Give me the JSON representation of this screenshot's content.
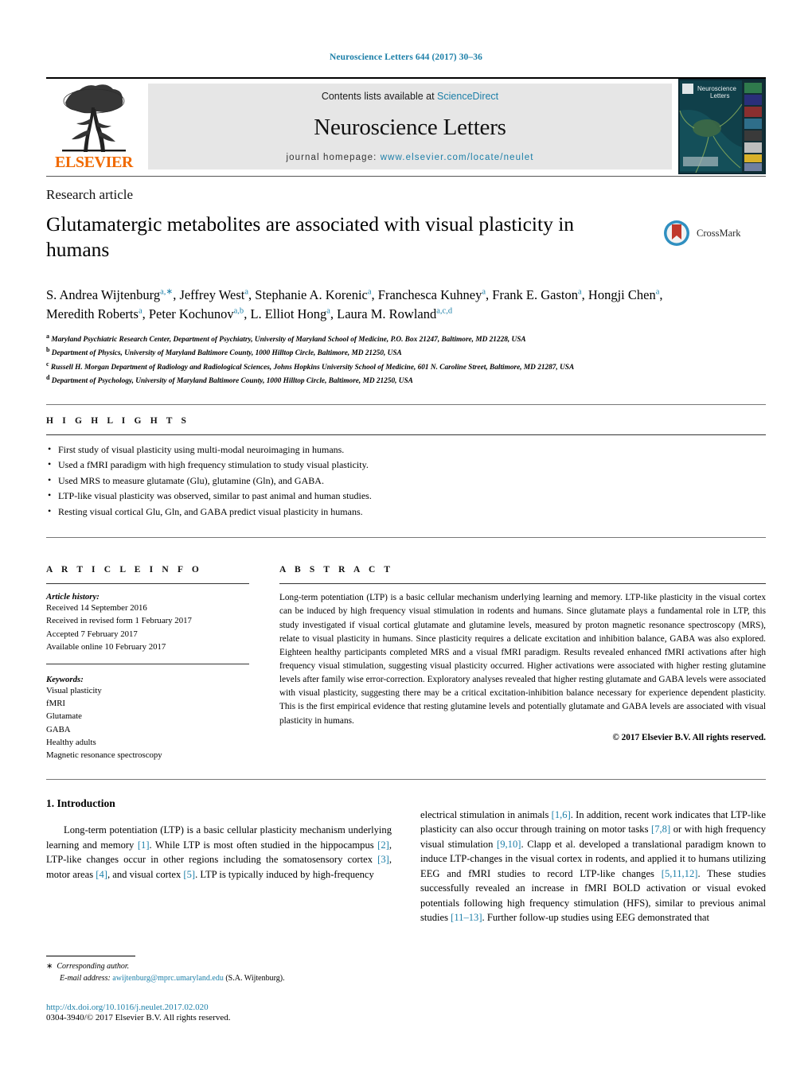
{
  "running_head": "Neuroscience Letters 644 (2017) 30–36",
  "masthead": {
    "publisher_name": "ELSEVIER",
    "contents_prefix": "Contents lists available at ",
    "contents_link": "ScienceDirect",
    "journal_name": "Neuroscience Letters",
    "homepage_prefix": "journal homepage: ",
    "homepage_link": "www.elsevier.com/locate/neulet",
    "cover_title": "Neuroscience Letters"
  },
  "article": {
    "type": "Research article",
    "title": "Glutamatergic metabolites are associated with visual plasticity in humans",
    "crossmark_label": "CrossMark",
    "authors_html": "S. Andrea Wijtenburg<sup>a,∗</sup>, Jeffrey West<sup>a</sup>, Stephanie A. Korenic<sup>a</sup>, Franchesca Kuhney<sup>a</sup>, Frank E. Gaston<sup>a</sup>, Hongji Chen<sup>a</sup>, Meredith Roberts<sup>a</sup>, Peter Kochunov<sup>a,b</sup>, L. Elliot Hong<sup>a</sup>, Laura M. Rowland<sup>a,c,d</sup>",
    "affiliations": [
      {
        "marker": "a",
        "text": "Maryland Psychiatric Research Center, Department of Psychiatry, University of Maryland School of Medicine, P.O. Box 21247, Baltimore, MD 21228, USA"
      },
      {
        "marker": "b",
        "text": "Department of Physics, University of Maryland Baltimore County, 1000 Hilltop Circle, Baltimore, MD 21250, USA"
      },
      {
        "marker": "c",
        "text": "Russell H. Morgan Department of Radiology and Radiological Sciences, Johns Hopkins University School of Medicine, 601 N. Caroline Street, Baltimore, MD 21287, USA"
      },
      {
        "marker": "d",
        "text": "Department of Psychology, University of Maryland Baltimore County, 1000 Hilltop Circle, Baltimore, MD 21250, USA"
      }
    ]
  },
  "highlights": {
    "heading": "H I G H L I G H T S",
    "items": [
      "First study of visual plasticity using multi-modal neuroimaging in humans.",
      "Used a fMRI paradigm with high frequency stimulation to study visual plasticity.",
      "Used MRS to measure glutamate (Glu), glutamine (Gln), and GABA.",
      "LTP-like visual plasticity was observed, similar to past animal and human studies.",
      "Resting visual cortical Glu, Gln, and GABA predict visual plasticity in humans."
    ]
  },
  "article_info": {
    "heading": "A R T I C L E   I N F O",
    "history_label": "Article history:",
    "history": [
      "Received 14 September 2016",
      "Received in revised form 1 February 2017",
      "Accepted 7 February 2017",
      "Available online 10 February 2017"
    ],
    "keywords_label": "Keywords:",
    "keywords": [
      "Visual plasticity",
      "fMRI",
      "Glutamate",
      "GABA",
      "Healthy adults",
      "Magnetic resonance spectroscopy"
    ]
  },
  "abstract": {
    "heading": "A B S T R A C T",
    "text": "Long-term potentiation (LTP) is a basic cellular mechanism underlying learning and memory. LTP-like plasticity in the visual cortex can be induced by high frequency visual stimulation in rodents and humans. Since glutamate plays a fundamental role in LTP, this study investigated if visual cortical glutamate and glutamine levels, measured by proton magnetic resonance spectroscopy (MRS), relate to visual plasticity in humans. Since plasticity requires a delicate excitation and inhibition balance, GABA was also explored. Eighteen healthy participants completed MRS and a visual fMRI paradigm. Results revealed enhanced fMRI activations after high frequency visual stimulation, suggesting visual plasticity occurred. Higher activations were associated with higher resting glutamine levels after family wise error-correction. Exploratory analyses revealed that higher resting glutamate and GABA levels were associated with visual plasticity, suggesting there may be a critical excitation-inhibition balance necessary for experience dependent plasticity. This is the first empirical evidence that resting glutamine levels and potentially glutamate and GABA levels are associated with visual plasticity in humans.",
    "copyright": "© 2017 Elsevier B.V. All rights reserved."
  },
  "body": {
    "section_number_title": "1.  Introduction",
    "left_paragraph_html": "Long-term potentiation (LTP) is a basic cellular plasticity mechanism underlying learning and memory <span class=\"link\">[1]</span>. While LTP is most often studied in the hippocampus <span class=\"link\">[2]</span>, LTP-like changes occur in other regions including the somatosensory cortex <span class=\"link\">[3]</span>, motor areas <span class=\"link\">[4]</span>, and visual cortex <span class=\"link\">[5]</span>. LTP is typically induced by high-frequency",
    "right_paragraph_html": "electrical stimulation in animals <span class=\"link\">[1,6]</span>. In addition, recent work indicates that LTP-like plasticity can also occur through training on motor tasks <span class=\"link\">[7,8]</span> or with high frequency visual stimulation <span class=\"link\">[9,10]</span>. Clapp et al. developed a translational paradigm known to induce LTP-changes in the visual cortex in rodents, and applied it to humans utilizing EEG and fMRI studies to record LTP-like changes <span class=\"link\">[5,11,12]</span>. These studies successfully revealed an increase in fMRI BOLD activation or visual evoked potentials following high frequency stimulation (HFS), similar to previous animal studies <span class=\"link\">[11–13]</span>. Further follow-up studies using EEG demonstrated that"
  },
  "footnotes": {
    "corresponding_star": "∗",
    "corresponding_label": "Corresponding author.",
    "email_label": "E-mail address:",
    "email": "awijtenburg@mprc.umaryland.edu",
    "email_suffix": "(S.A. Wijtenburg).",
    "doi": "http://dx.doi.org/10.1016/j.neulet.2017.02.020",
    "issn": "0304-3940/© 2017 Elsevier B.V. All rights reserved."
  },
  "colors": {
    "link_blue": "#1c7fa8",
    "elsevier_orange": "#f06a00",
    "masthead_grey": "#e6e6e6"
  }
}
